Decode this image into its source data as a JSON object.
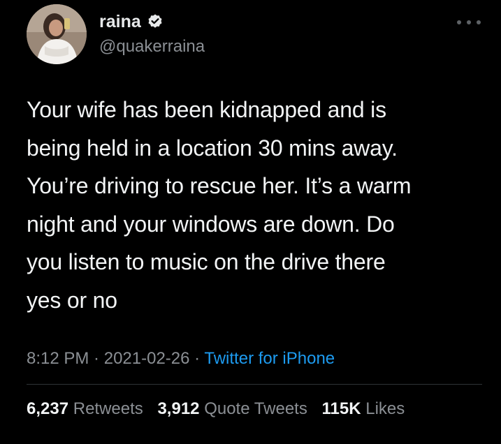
{
  "author": {
    "display_name": "raina",
    "handle": "@quakerraina",
    "verified": true
  },
  "tweet": {
    "text": "Your wife has been kidnapped and is\nbeing held in a location 30 mins away.\nYou’re driving to rescue her. It’s a warm\nnight and your windows are down. Do\nyou listen to music on the drive there\nyes or no"
  },
  "meta": {
    "time": "8:12 PM",
    "separator": " · ",
    "date": "2021-02-26",
    "source": "Twitter for iPhone"
  },
  "stats": {
    "retweets": {
      "count": "6,237",
      "label": "Retweets"
    },
    "quote_tweets": {
      "count": "3,912",
      "label": "Quote Tweets"
    },
    "likes": {
      "count": "115K",
      "label": "Likes"
    }
  },
  "icons": {
    "verified": "verified-badge-icon",
    "more": "more-options-icon"
  },
  "colors": {
    "background": "#000000",
    "text": "#e7e9ea",
    "secondary_text": "#8b8f94",
    "link": "#1d9bf0",
    "divider": "#2f3336"
  }
}
